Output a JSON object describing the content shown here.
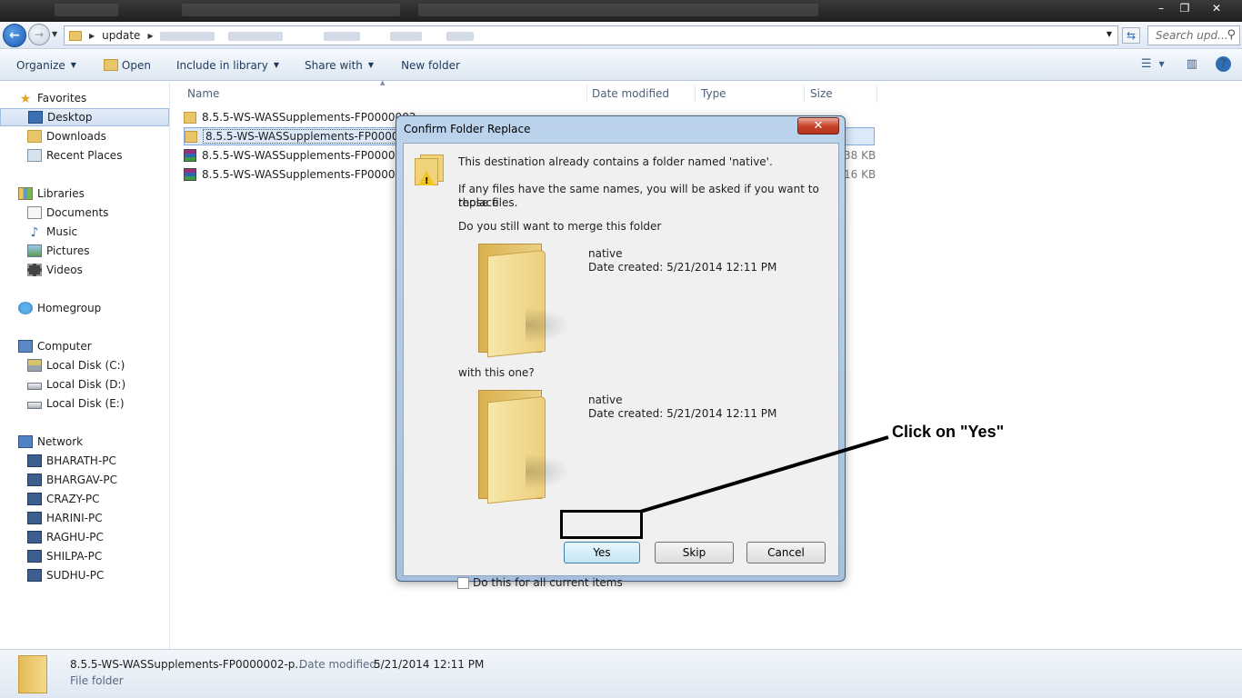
{
  "window": {
    "minimize_glyph": "–",
    "maximize_glyph": "❐",
    "close_glyph": "✕"
  },
  "address": {
    "path": "update",
    "search_placeholder": "Search upd..."
  },
  "toolbar": {
    "organize": "Organize",
    "open": "Open",
    "include_in_library": "Include in library",
    "share_with": "Share with",
    "new_folder": "New folder",
    "help_glyph": "?"
  },
  "nav": {
    "favorites": "Favorites",
    "desktop": "Desktop",
    "downloads": "Downloads",
    "recent_places": "Recent Places",
    "libraries": "Libraries",
    "documents": "Documents",
    "music": "Music",
    "pictures": "Pictures",
    "videos": "Videos",
    "homegroup": "Homegroup",
    "computer": "Computer",
    "local_c": "Local Disk (C:)",
    "local_d": "Local Disk (D:)",
    "local_e": "Local Disk (E:)",
    "network": "Network",
    "pcs": [
      "BHARATH-PC",
      "BHARGAV-PC",
      "CRAZY-PC",
      "HARINI-PC",
      "RAGHU-PC",
      "SHILPA-PC",
      "SUDHU-PC"
    ]
  },
  "columns": {
    "name": "Name",
    "date_modified": "Date modified",
    "type": "Type",
    "size": "Size"
  },
  "files": [
    {
      "name": "8.5.5-WS-WASSupplements-FP0000002"
    },
    {
      "name": "8.5.5-WS-WASSupplements-FP0000002"
    },
    {
      "name": "8.5.5-WS-WASSupplements-FP0000002-",
      "size_peek": "38 KB"
    },
    {
      "name": "8.5.5-WS-WASSupplements-FP0000002-",
      "size_peek": "16 KB"
    }
  ],
  "details": {
    "name": "8.5.5-WS-WASSupplements-FP0000002-p...",
    "date_modified_label": "Date modified:",
    "date_modified_value": "5/21/2014 12:11 PM",
    "type": "File folder"
  },
  "dialog": {
    "title": "Confirm Folder Replace",
    "close_glyph": "✕",
    "line1": "This destination already contains a folder named 'native'.",
    "line2a": "If any files have the same names, you will be asked if you want to replace",
    "line2b": "those files.",
    "line3": "Do you still want to merge this folder",
    "folder1_name": "native",
    "folder1_date": "Date created: 5/21/2014 12:11 PM",
    "with_this": "with this one?",
    "folder2_name": "native",
    "folder2_date": "Date created: 5/21/2014 12:11 PM",
    "yes": "Yes",
    "skip": "Skip",
    "cancel": "Cancel",
    "checkbox_label": "Do this for all current items"
  },
  "annotation": {
    "text": "Click on \"Yes\""
  }
}
